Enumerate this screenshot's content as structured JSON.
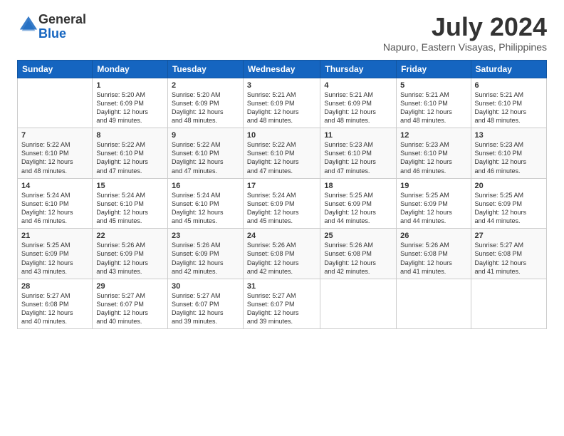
{
  "logo": {
    "general": "General",
    "blue": "Blue"
  },
  "header": {
    "title": "July 2024",
    "subtitle": "Napuro, Eastern Visayas, Philippines"
  },
  "days_of_week": [
    "Sunday",
    "Monday",
    "Tuesday",
    "Wednesday",
    "Thursday",
    "Friday",
    "Saturday"
  ],
  "weeks": [
    [
      {
        "day": "",
        "info": ""
      },
      {
        "day": "1",
        "info": "Sunrise: 5:20 AM\nSunset: 6:09 PM\nDaylight: 12 hours\nand 49 minutes."
      },
      {
        "day": "2",
        "info": "Sunrise: 5:20 AM\nSunset: 6:09 PM\nDaylight: 12 hours\nand 48 minutes."
      },
      {
        "day": "3",
        "info": "Sunrise: 5:21 AM\nSunset: 6:09 PM\nDaylight: 12 hours\nand 48 minutes."
      },
      {
        "day": "4",
        "info": "Sunrise: 5:21 AM\nSunset: 6:09 PM\nDaylight: 12 hours\nand 48 minutes."
      },
      {
        "day": "5",
        "info": "Sunrise: 5:21 AM\nSunset: 6:10 PM\nDaylight: 12 hours\nand 48 minutes."
      },
      {
        "day": "6",
        "info": "Sunrise: 5:21 AM\nSunset: 6:10 PM\nDaylight: 12 hours\nand 48 minutes."
      }
    ],
    [
      {
        "day": "7",
        "info": "Sunrise: 5:22 AM\nSunset: 6:10 PM\nDaylight: 12 hours\nand 48 minutes."
      },
      {
        "day": "8",
        "info": "Sunrise: 5:22 AM\nSunset: 6:10 PM\nDaylight: 12 hours\nand 47 minutes."
      },
      {
        "day": "9",
        "info": "Sunrise: 5:22 AM\nSunset: 6:10 PM\nDaylight: 12 hours\nand 47 minutes."
      },
      {
        "day": "10",
        "info": "Sunrise: 5:22 AM\nSunset: 6:10 PM\nDaylight: 12 hours\nand 47 minutes."
      },
      {
        "day": "11",
        "info": "Sunrise: 5:23 AM\nSunset: 6:10 PM\nDaylight: 12 hours\nand 47 minutes."
      },
      {
        "day": "12",
        "info": "Sunrise: 5:23 AM\nSunset: 6:10 PM\nDaylight: 12 hours\nand 46 minutes."
      },
      {
        "day": "13",
        "info": "Sunrise: 5:23 AM\nSunset: 6:10 PM\nDaylight: 12 hours\nand 46 minutes."
      }
    ],
    [
      {
        "day": "14",
        "info": "Sunrise: 5:24 AM\nSunset: 6:10 PM\nDaylight: 12 hours\nand 46 minutes."
      },
      {
        "day": "15",
        "info": "Sunrise: 5:24 AM\nSunset: 6:10 PM\nDaylight: 12 hours\nand 45 minutes."
      },
      {
        "day": "16",
        "info": "Sunrise: 5:24 AM\nSunset: 6:10 PM\nDaylight: 12 hours\nand 45 minutes."
      },
      {
        "day": "17",
        "info": "Sunrise: 5:24 AM\nSunset: 6:09 PM\nDaylight: 12 hours\nand 45 minutes."
      },
      {
        "day": "18",
        "info": "Sunrise: 5:25 AM\nSunset: 6:09 PM\nDaylight: 12 hours\nand 44 minutes."
      },
      {
        "day": "19",
        "info": "Sunrise: 5:25 AM\nSunset: 6:09 PM\nDaylight: 12 hours\nand 44 minutes."
      },
      {
        "day": "20",
        "info": "Sunrise: 5:25 AM\nSunset: 6:09 PM\nDaylight: 12 hours\nand 44 minutes."
      }
    ],
    [
      {
        "day": "21",
        "info": "Sunrise: 5:25 AM\nSunset: 6:09 PM\nDaylight: 12 hours\nand 43 minutes."
      },
      {
        "day": "22",
        "info": "Sunrise: 5:26 AM\nSunset: 6:09 PM\nDaylight: 12 hours\nand 43 minutes."
      },
      {
        "day": "23",
        "info": "Sunrise: 5:26 AM\nSunset: 6:09 PM\nDaylight: 12 hours\nand 42 minutes."
      },
      {
        "day": "24",
        "info": "Sunrise: 5:26 AM\nSunset: 6:08 PM\nDaylight: 12 hours\nand 42 minutes."
      },
      {
        "day": "25",
        "info": "Sunrise: 5:26 AM\nSunset: 6:08 PM\nDaylight: 12 hours\nand 42 minutes."
      },
      {
        "day": "26",
        "info": "Sunrise: 5:26 AM\nSunset: 6:08 PM\nDaylight: 12 hours\nand 41 minutes."
      },
      {
        "day": "27",
        "info": "Sunrise: 5:27 AM\nSunset: 6:08 PM\nDaylight: 12 hours\nand 41 minutes."
      }
    ],
    [
      {
        "day": "28",
        "info": "Sunrise: 5:27 AM\nSunset: 6:08 PM\nDaylight: 12 hours\nand 40 minutes."
      },
      {
        "day": "29",
        "info": "Sunrise: 5:27 AM\nSunset: 6:07 PM\nDaylight: 12 hours\nand 40 minutes."
      },
      {
        "day": "30",
        "info": "Sunrise: 5:27 AM\nSunset: 6:07 PM\nDaylight: 12 hours\nand 39 minutes."
      },
      {
        "day": "31",
        "info": "Sunrise: 5:27 AM\nSunset: 6:07 PM\nDaylight: 12 hours\nand 39 minutes."
      },
      {
        "day": "",
        "info": ""
      },
      {
        "day": "",
        "info": ""
      },
      {
        "day": "",
        "info": ""
      }
    ]
  ]
}
